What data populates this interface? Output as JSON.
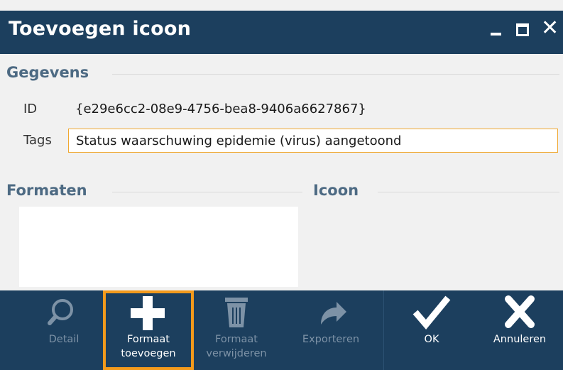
{
  "window": {
    "title": "Toevoegen icoon",
    "controls": [
      "minimize",
      "maximize",
      "close"
    ]
  },
  "gegevens": {
    "heading": "Gegevens",
    "id_label": "ID",
    "id_value": "{e29e6cc2-08e9-4756-bea8-9406a6627867}",
    "tags_label": "Tags",
    "tags_value": "Status waarschuwing epidemie (virus) aangetoond"
  },
  "formaten": {
    "heading": "Formaten"
  },
  "icoon": {
    "heading": "Icoon"
  },
  "toolbar": {
    "detail": {
      "label": "Detail",
      "icon": "search-icon",
      "enabled": false
    },
    "add_format": {
      "line1": "Formaat",
      "line2": "toevoegen",
      "icon": "plus-icon",
      "enabled": true,
      "selected": true
    },
    "remove_format": {
      "line1": "Formaat",
      "line2": "verwijderen",
      "icon": "trash-icon",
      "enabled": false
    },
    "export": {
      "label": "Exporteren",
      "icon": "share-arrow-icon",
      "enabled": false
    },
    "ok": {
      "label": "OK",
      "icon": "checkmark-icon",
      "enabled": true
    },
    "cancel": {
      "label": "Annuleren",
      "icon": "x-icon",
      "enabled": true
    }
  },
  "colors": {
    "titlebar": "#1c3f5e",
    "section_heading": "#4d6a83",
    "selection_border": "#f39a1c",
    "input_focus_border": "#f0a830",
    "disabled_text": "#7d92a6"
  }
}
